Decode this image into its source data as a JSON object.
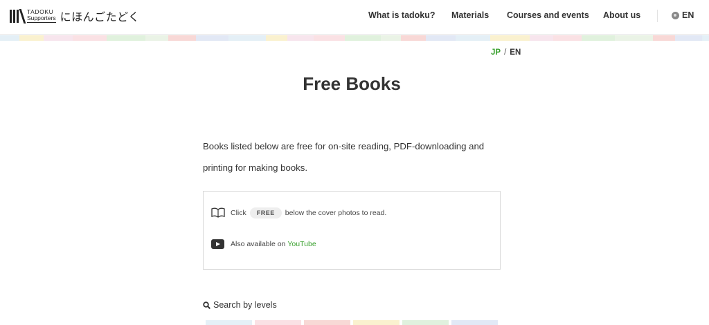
{
  "header": {
    "logo": {
      "line1": "TADOKU",
      "line2": "Supporters",
      "jp_name": "にほんごたどく"
    },
    "nav": [
      {
        "label": "What is tadoku?"
      },
      {
        "label": "Materials"
      },
      {
        "label": "Courses and events"
      },
      {
        "label": "About us"
      }
    ],
    "language": {
      "icon": "globe-icon",
      "label": "EN"
    }
  },
  "colors": {
    "accent_green": "#3aa12f",
    "stripe": [
      "#cfe3f0",
      "#f6c9cf",
      "#f3b9b5",
      "#f6e6a8",
      "#c7e6c2",
      "#cbd7ee",
      "#f1d0e0",
      "#d9ead3"
    ]
  },
  "lang_switch": {
    "jp": "JP",
    "separator": "/",
    "en": "EN"
  },
  "page_title": "Free Books",
  "intro": "Books listed below are free for on-site reading, PDF-downloading and printing for making books.",
  "info": {
    "row1": {
      "icon": "open-book-icon",
      "before": "Click",
      "badge": "FREE",
      "after": "below the cover photos to read."
    },
    "row2": {
      "icon": "youtube-icon",
      "text": "Also available on",
      "link": "YouTube"
    }
  },
  "search": {
    "icon": "search-icon",
    "label": "Search by levels"
  }
}
